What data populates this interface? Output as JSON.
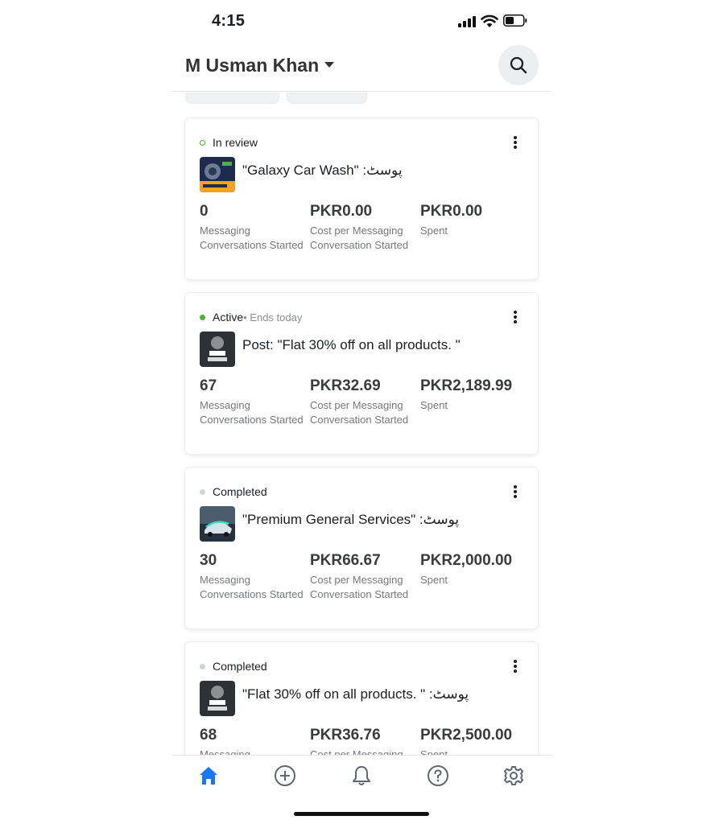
{
  "status_bar": {
    "time": "4:15"
  },
  "header": {
    "account_name": "M Usman Khan"
  },
  "campaigns": [
    {
      "status": "In review",
      "status_extra": "",
      "status_kind": "review",
      "title": "\"Galaxy Car Wash\" :پوسٹ",
      "metrics": [
        {
          "value": "0",
          "label": "Messaging Conversations Started"
        },
        {
          "value": "PKR0.00",
          "label": "Cost per Messaging Conversation Started"
        },
        {
          "value": "PKR0.00",
          "label": "Spent"
        }
      ]
    },
    {
      "status": "Active",
      "status_extra": " • Ends today",
      "status_kind": "active",
      "title": "Post: \"Flat 30% off on all products. \"",
      "metrics": [
        {
          "value": "67",
          "label": "Messaging Conversations Started"
        },
        {
          "value": "PKR32.69",
          "label": "Cost per Messaging Conversation Started"
        },
        {
          "value": "PKR2,189.99",
          "label": "Spent"
        }
      ]
    },
    {
      "status": "Completed",
      "status_extra": "",
      "status_kind": "completed",
      "title": "\"Premium General Services\" :پوسٹ",
      "metrics": [
        {
          "value": "30",
          "label": "Messaging Conversations Started"
        },
        {
          "value": "PKR66.67",
          "label": "Cost per Messaging Conversation Started"
        },
        {
          "value": "PKR2,000.00",
          "label": "Spent"
        }
      ]
    },
    {
      "status": "Completed",
      "status_extra": "",
      "status_kind": "completed",
      "title": "\"Flat 30% off on all products. \" :پوسٹ",
      "metrics": [
        {
          "value": "68",
          "label": "Messaging Conversations Started"
        },
        {
          "value": "PKR36.76",
          "label": "Cost per Messaging Conversation Started"
        },
        {
          "value": "PKR2,500.00",
          "label": "Spent"
        }
      ]
    }
  ],
  "tab_bar": {
    "tabs": [
      {
        "icon": "home-icon",
        "active": true
      },
      {
        "icon": "add-circle-icon",
        "active": false
      },
      {
        "icon": "bell-icon",
        "active": false
      },
      {
        "icon": "help-icon",
        "active": false
      },
      {
        "icon": "gear-icon",
        "active": false
      }
    ],
    "active_color": "#1877f2",
    "inactive_color": "#606770"
  },
  "colors": {
    "status_green": "#42b72a",
    "status_grey": "#cfd2d6"
  }
}
